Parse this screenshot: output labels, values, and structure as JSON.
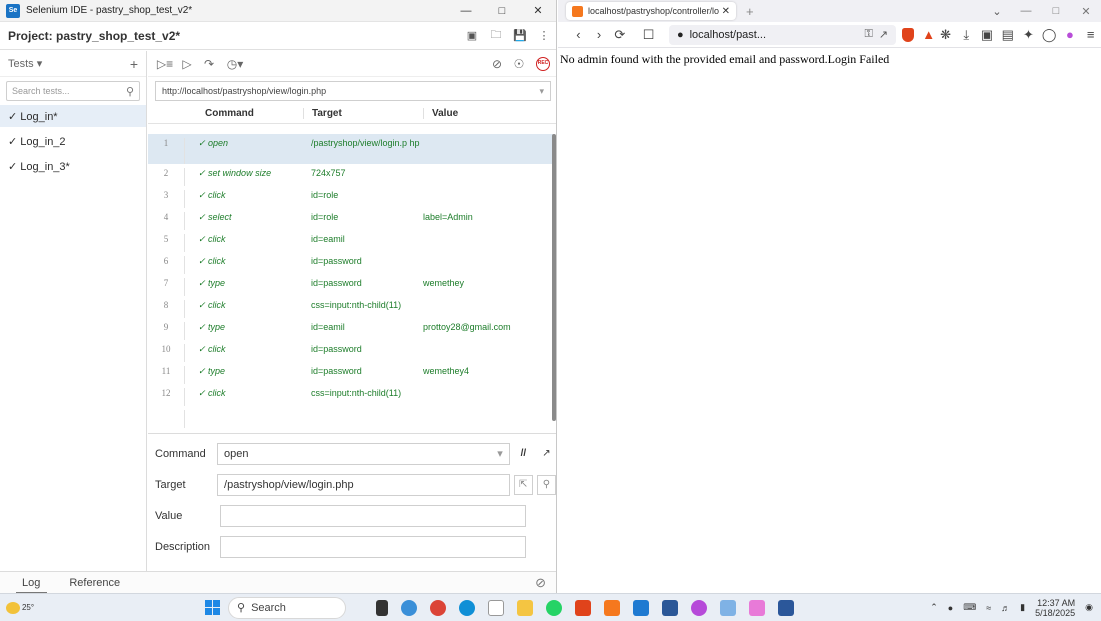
{
  "selenium": {
    "window_title": "Selenium IDE - pastry_shop_test_v2*",
    "project_title": "Project: pastry_shop_test_v2*",
    "tests_label": "Tests",
    "search_placeholder": "Search tests...",
    "tests": [
      {
        "label": "✓ Log_in*",
        "active": true
      },
      {
        "label": "✓ Log_in_2",
        "active": false
      },
      {
        "label": "✓ Log_in_3*",
        "active": false
      }
    ],
    "base_url": "http://localhost/pastryshop/view/login.php",
    "columns": {
      "command": "Command",
      "target": "Target",
      "value": "Value"
    },
    "commands": [
      {
        "num": "1",
        "command": "✓ open",
        "target": "/pastryshop/view/login.p hp",
        "value": ""
      },
      {
        "num": "2",
        "command": "✓ set window size",
        "target": "724x757",
        "value": ""
      },
      {
        "num": "3",
        "command": "✓ click",
        "target": "id=role",
        "value": ""
      },
      {
        "num": "4",
        "command": "✓ select",
        "target": "id=role",
        "value": "label=Admin"
      },
      {
        "num": "5",
        "command": "✓ click",
        "target": "id=eamil",
        "value": ""
      },
      {
        "num": "6",
        "command": "✓ click",
        "target": "id=password",
        "value": ""
      },
      {
        "num": "7",
        "command": "✓ type",
        "target": "id=password",
        "value": "wemethey"
      },
      {
        "num": "8",
        "command": "✓ click",
        "target": "css=input:nth-child(11)",
        "value": ""
      },
      {
        "num": "9",
        "command": "✓ type",
        "target": "id=eamil",
        "value": "prottoy28@gmail.com"
      },
      {
        "num": "10",
        "command": "✓ click",
        "target": "id=password",
        "value": ""
      },
      {
        "num": "11",
        "command": "✓ type",
        "target": "id=password",
        "value": "wemethey4"
      },
      {
        "num": "12",
        "command": "✓ click",
        "target": "css=input:nth-child(11)",
        "value": ""
      }
    ],
    "editor": {
      "command_label": "Command",
      "command_value": "open",
      "target_label": "Target",
      "target_value": "/pastryshop/view/login.php",
      "value_label": "Value",
      "description_label": "Description"
    },
    "bottom_tabs": [
      "Log",
      "Reference"
    ]
  },
  "firefox": {
    "tab_title": "localhost/pastryshop/controller/lo",
    "url": "localhost/past...",
    "page_text": "No admin found with the provided email and password.Login Failed"
  },
  "taskbar": {
    "weather": "25°",
    "search_label": "Search",
    "time": "12:37 AM",
    "date": "5/18/2025"
  },
  "colors": {
    "pass_green": "#1d7d2a",
    "selected_row": "#dde8f2",
    "record_red": "#d02020"
  }
}
